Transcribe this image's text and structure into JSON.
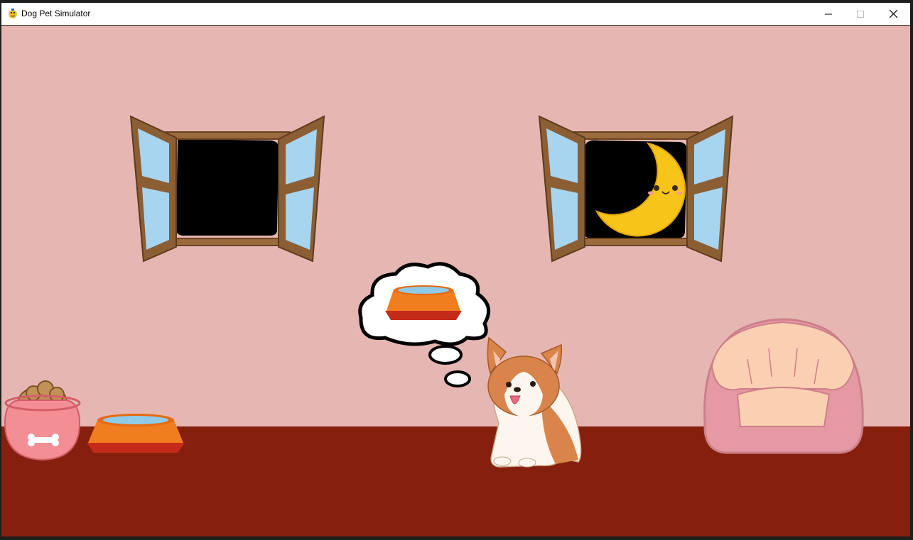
{
  "window": {
    "title": "Dog Pet Simulator",
    "app_icon": "pygame-snake-icon",
    "controls": [
      "minimize-icon",
      "maximize-icon",
      "close-icon"
    ]
  },
  "scene": {
    "time_of_day": "night",
    "wall_color": "#e6b7b2",
    "floor_color": "#86200e",
    "left_window": {
      "state": "open",
      "view": "night-sky"
    },
    "right_window": {
      "state": "open",
      "view": "crescent-moon"
    },
    "dog": {
      "breed": "corgi",
      "thought": "water-bowl"
    },
    "items": [
      "food-bowl",
      "water-bowl",
      "dog-bed"
    ]
  }
}
